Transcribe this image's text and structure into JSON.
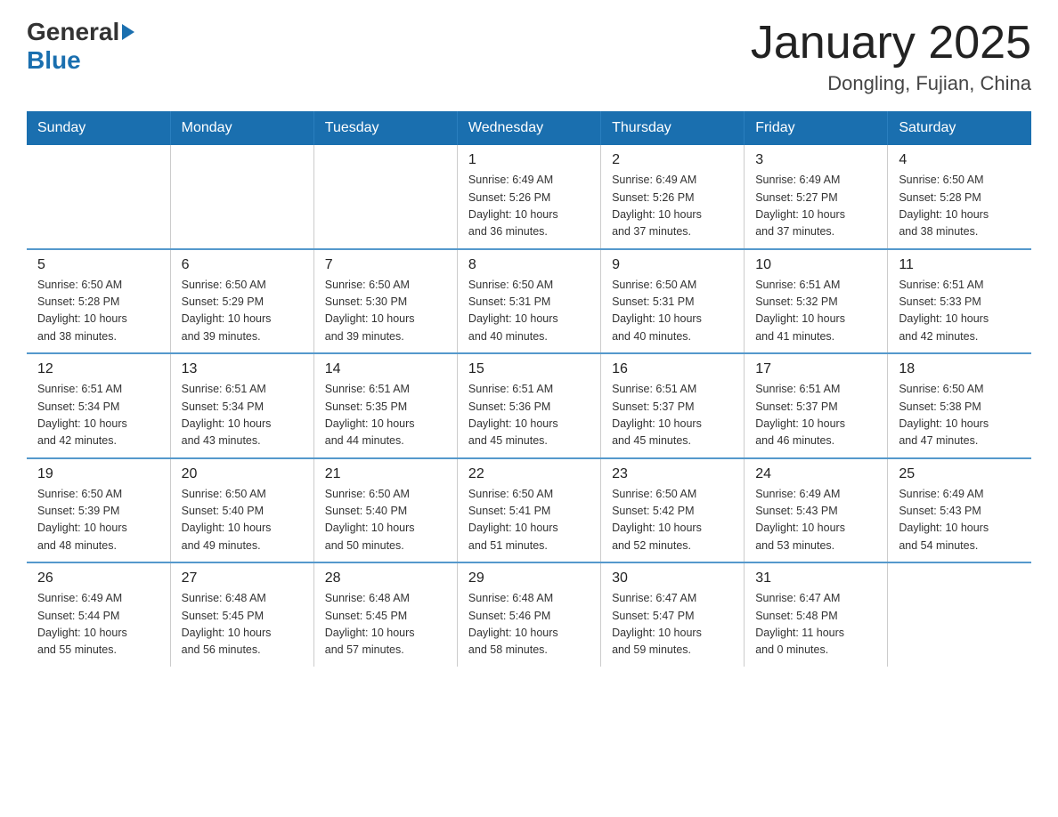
{
  "header": {
    "logo_black": "General",
    "logo_blue": "Blue",
    "title": "January 2025",
    "subtitle": "Dongling, Fujian, China"
  },
  "days_of_week": [
    "Sunday",
    "Monday",
    "Tuesday",
    "Wednesday",
    "Thursday",
    "Friday",
    "Saturday"
  ],
  "weeks": [
    [
      {
        "day": "",
        "info": ""
      },
      {
        "day": "",
        "info": ""
      },
      {
        "day": "",
        "info": ""
      },
      {
        "day": "1",
        "info": "Sunrise: 6:49 AM\nSunset: 5:26 PM\nDaylight: 10 hours\nand 36 minutes."
      },
      {
        "day": "2",
        "info": "Sunrise: 6:49 AM\nSunset: 5:26 PM\nDaylight: 10 hours\nand 37 minutes."
      },
      {
        "day": "3",
        "info": "Sunrise: 6:49 AM\nSunset: 5:27 PM\nDaylight: 10 hours\nand 37 minutes."
      },
      {
        "day": "4",
        "info": "Sunrise: 6:50 AM\nSunset: 5:28 PM\nDaylight: 10 hours\nand 38 minutes."
      }
    ],
    [
      {
        "day": "5",
        "info": "Sunrise: 6:50 AM\nSunset: 5:28 PM\nDaylight: 10 hours\nand 38 minutes."
      },
      {
        "day": "6",
        "info": "Sunrise: 6:50 AM\nSunset: 5:29 PM\nDaylight: 10 hours\nand 39 minutes."
      },
      {
        "day": "7",
        "info": "Sunrise: 6:50 AM\nSunset: 5:30 PM\nDaylight: 10 hours\nand 39 minutes."
      },
      {
        "day": "8",
        "info": "Sunrise: 6:50 AM\nSunset: 5:31 PM\nDaylight: 10 hours\nand 40 minutes."
      },
      {
        "day": "9",
        "info": "Sunrise: 6:50 AM\nSunset: 5:31 PM\nDaylight: 10 hours\nand 40 minutes."
      },
      {
        "day": "10",
        "info": "Sunrise: 6:51 AM\nSunset: 5:32 PM\nDaylight: 10 hours\nand 41 minutes."
      },
      {
        "day": "11",
        "info": "Sunrise: 6:51 AM\nSunset: 5:33 PM\nDaylight: 10 hours\nand 42 minutes."
      }
    ],
    [
      {
        "day": "12",
        "info": "Sunrise: 6:51 AM\nSunset: 5:34 PM\nDaylight: 10 hours\nand 42 minutes."
      },
      {
        "day": "13",
        "info": "Sunrise: 6:51 AM\nSunset: 5:34 PM\nDaylight: 10 hours\nand 43 minutes."
      },
      {
        "day": "14",
        "info": "Sunrise: 6:51 AM\nSunset: 5:35 PM\nDaylight: 10 hours\nand 44 minutes."
      },
      {
        "day": "15",
        "info": "Sunrise: 6:51 AM\nSunset: 5:36 PM\nDaylight: 10 hours\nand 45 minutes."
      },
      {
        "day": "16",
        "info": "Sunrise: 6:51 AM\nSunset: 5:37 PM\nDaylight: 10 hours\nand 45 minutes."
      },
      {
        "day": "17",
        "info": "Sunrise: 6:51 AM\nSunset: 5:37 PM\nDaylight: 10 hours\nand 46 minutes."
      },
      {
        "day": "18",
        "info": "Sunrise: 6:50 AM\nSunset: 5:38 PM\nDaylight: 10 hours\nand 47 minutes."
      }
    ],
    [
      {
        "day": "19",
        "info": "Sunrise: 6:50 AM\nSunset: 5:39 PM\nDaylight: 10 hours\nand 48 minutes."
      },
      {
        "day": "20",
        "info": "Sunrise: 6:50 AM\nSunset: 5:40 PM\nDaylight: 10 hours\nand 49 minutes."
      },
      {
        "day": "21",
        "info": "Sunrise: 6:50 AM\nSunset: 5:40 PM\nDaylight: 10 hours\nand 50 minutes."
      },
      {
        "day": "22",
        "info": "Sunrise: 6:50 AM\nSunset: 5:41 PM\nDaylight: 10 hours\nand 51 minutes."
      },
      {
        "day": "23",
        "info": "Sunrise: 6:50 AM\nSunset: 5:42 PM\nDaylight: 10 hours\nand 52 minutes."
      },
      {
        "day": "24",
        "info": "Sunrise: 6:49 AM\nSunset: 5:43 PM\nDaylight: 10 hours\nand 53 minutes."
      },
      {
        "day": "25",
        "info": "Sunrise: 6:49 AM\nSunset: 5:43 PM\nDaylight: 10 hours\nand 54 minutes."
      }
    ],
    [
      {
        "day": "26",
        "info": "Sunrise: 6:49 AM\nSunset: 5:44 PM\nDaylight: 10 hours\nand 55 minutes."
      },
      {
        "day": "27",
        "info": "Sunrise: 6:48 AM\nSunset: 5:45 PM\nDaylight: 10 hours\nand 56 minutes."
      },
      {
        "day": "28",
        "info": "Sunrise: 6:48 AM\nSunset: 5:45 PM\nDaylight: 10 hours\nand 57 minutes."
      },
      {
        "day": "29",
        "info": "Sunrise: 6:48 AM\nSunset: 5:46 PM\nDaylight: 10 hours\nand 58 minutes."
      },
      {
        "day": "30",
        "info": "Sunrise: 6:47 AM\nSunset: 5:47 PM\nDaylight: 10 hours\nand 59 minutes."
      },
      {
        "day": "31",
        "info": "Sunrise: 6:47 AM\nSunset: 5:48 PM\nDaylight: 11 hours\nand 0 minutes."
      },
      {
        "day": "",
        "info": ""
      }
    ]
  ]
}
